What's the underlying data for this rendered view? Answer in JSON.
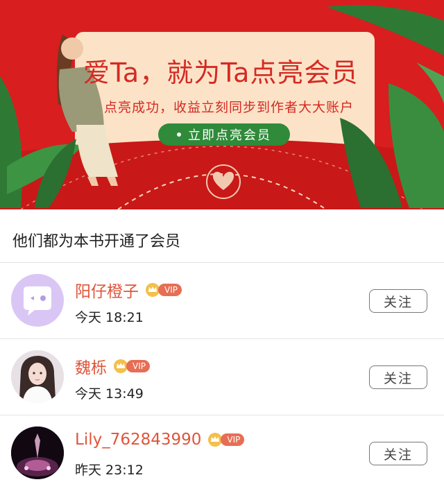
{
  "banner": {
    "title": "爱Ta，就为Ta点亮会员",
    "subtitle": "点亮成功，收益立刻同步到作者大大账户",
    "button_label": "立即点亮会员",
    "colors": {
      "background": "#d81e1e",
      "card": "#fce3c8",
      "button": "#2f8a3a"
    }
  },
  "section": {
    "title": "他们都为本书开通了会员"
  },
  "members": [
    {
      "name": "阳仔橙子",
      "vip_label": "VIP",
      "time": "今天 18:21",
      "follow_label": "关注",
      "avatar": "chat-bubble-avatar"
    },
    {
      "name": "魏栎",
      "vip_label": "VIP",
      "time": "今天 13:49",
      "follow_label": "关注",
      "avatar": "photo-avatar-girl"
    },
    {
      "name": "Lily_762843990",
      "vip_label": "VIP",
      "time": "昨天 23:12",
      "follow_label": "关注",
      "avatar": "photo-avatar-night"
    }
  ]
}
